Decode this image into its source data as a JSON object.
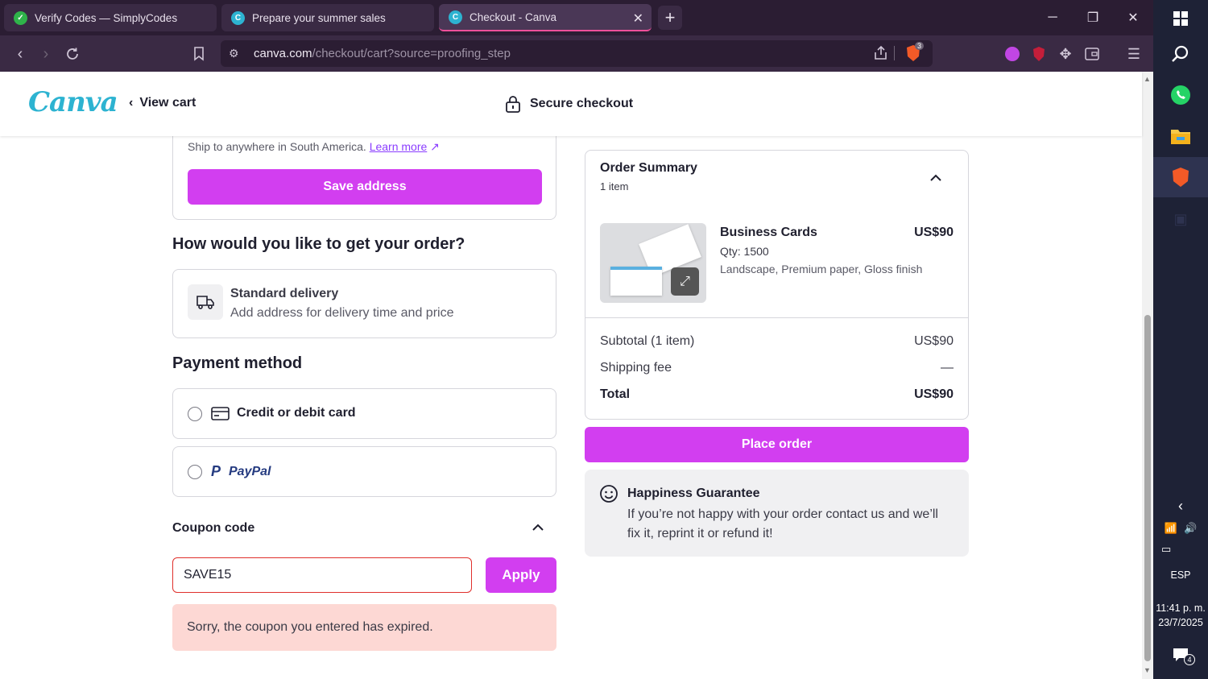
{
  "browser": {
    "tabs": [
      {
        "title": "Verify Codes — SimplyCodes",
        "active": false
      },
      {
        "title": "Prepare your summer sales",
        "active": false
      },
      {
        "title": "Checkout - Canva",
        "active": true
      }
    ],
    "url_domain": "canva.com",
    "url_path": "/checkout/cart?source=proofing_step",
    "shield_badge": "3"
  },
  "header": {
    "logo": "Canva",
    "back_label": "View cart",
    "secure_label": "Secure checkout"
  },
  "address": {
    "ship_note": "Ship to anywhere in South America.",
    "learn_more": "Learn more",
    "save_label": "Save address"
  },
  "delivery": {
    "heading": "How would you like to get your order?",
    "option_title": "Standard delivery",
    "option_sub": "Add address for delivery time and price"
  },
  "payment": {
    "heading": "Payment method",
    "card_label": "Credit or debit card",
    "paypal_label": "PayPal"
  },
  "coupon": {
    "heading": "Coupon code",
    "value": "SAVE15",
    "apply_label": "Apply",
    "error": "Sorry, the coupon you entered has expired."
  },
  "summary": {
    "title": "Order Summary",
    "count": "1 item",
    "product_name": "Business Cards",
    "product_price": "US$90",
    "product_qty": "Qty: 1500",
    "product_desc": "Landscape, Premium paper, Gloss finish",
    "subtotal_label": "Subtotal (1 item)",
    "subtotal_value": "US$90",
    "shipping_label": "Shipping fee",
    "shipping_value": "—",
    "total_label": "Total",
    "total_value": "US$90",
    "place_order": "Place order"
  },
  "guarantee": {
    "title": "Happiness Guarantee",
    "text": "If you’re not happy with your order contact us and we’ll fix it, reprint it or refund it!"
  },
  "taskbar": {
    "lang": "ESP",
    "time": "11:41 p. m.",
    "date": "23/7/2025",
    "notif_count": "4"
  },
  "colors": {
    "accent": "#d23ef0",
    "chrome_dark": "#2b1d33",
    "chrome": "#3a2a44",
    "error_bg": "#fdd8d4",
    "error_border": "#e0302c"
  }
}
